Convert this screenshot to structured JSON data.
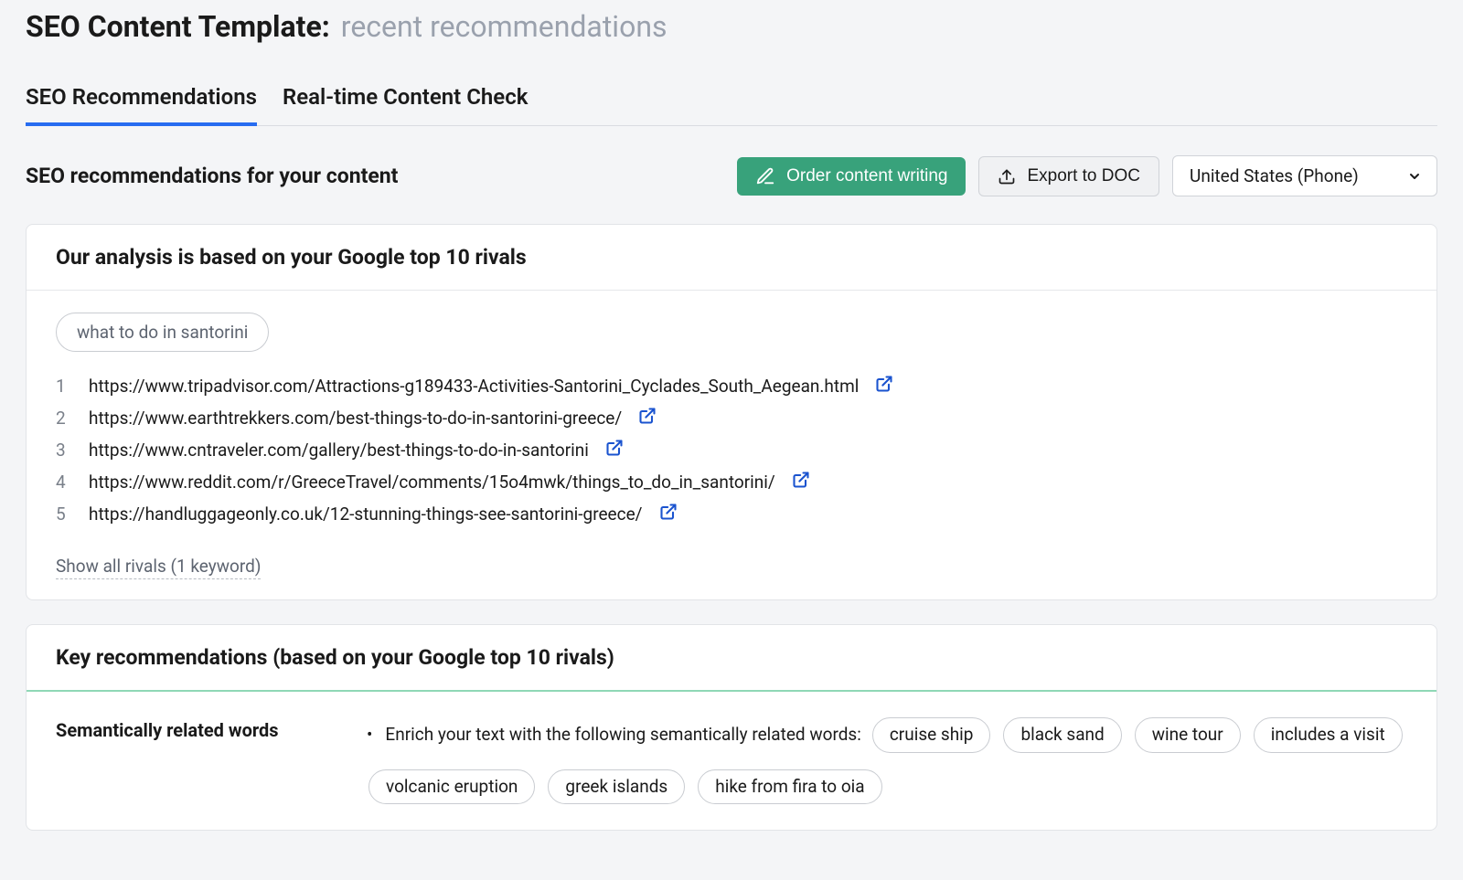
{
  "header": {
    "title_prefix": "SEO Content Template:",
    "title_subject": "recent recommendations"
  },
  "tabs": [
    {
      "label": "SEO Recommendations",
      "active": true
    },
    {
      "label": "Real-time Content Check",
      "active": false
    }
  ],
  "section": {
    "title": "SEO recommendations for your content",
    "order_label": "Order content writing",
    "export_label": "Export to DOC",
    "region_selected": "United States (Phone)"
  },
  "rivals": {
    "card_title": "Our analysis is based on your Google top 10 rivals",
    "keyword": "what to do in santorini",
    "items": [
      {
        "n": "1",
        "url": "https://www.tripadvisor.com/Attractions-g189433-Activities-Santorini_Cyclades_South_Aegean.html"
      },
      {
        "n": "2",
        "url": "https://www.earthtrekkers.com/best-things-to-do-in-santorini-greece/"
      },
      {
        "n": "3",
        "url": "https://www.cntraveler.com/gallery/best-things-to-do-in-santorini"
      },
      {
        "n": "4",
        "url": "https://www.reddit.com/r/GreeceTravel/comments/15o4mwk/things_to_do_in_santorini/"
      },
      {
        "n": "5",
        "url": "https://handluggageonly.co.uk/12-stunning-things-see-santorini-greece/"
      }
    ],
    "show_all_label": "Show all rivals (1 keyword)"
  },
  "recommendations": {
    "card_title": "Key recommendations (based on your Google top 10 rivals)",
    "semantic_label": "Semantically related words",
    "semantic_intro": "Enrich your text with the following semantically related words:",
    "semantic_words": [
      "cruise ship",
      "black sand",
      "wine tour",
      "includes a visit",
      "volcanic eruption",
      "greek islands",
      "hike from fira to oia"
    ]
  }
}
